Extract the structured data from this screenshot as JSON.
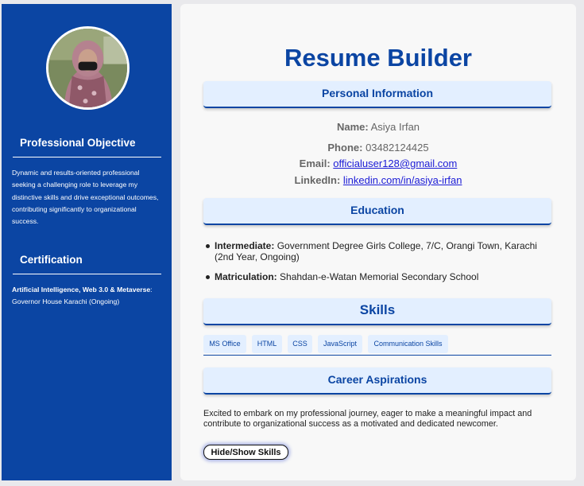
{
  "sidebar": {
    "objective_heading": "Professional Objective",
    "objective_text": "Dynamic and results-oriented professional seeking a challenging role to leverage my distinctive skills and drive exceptional outcomes, contributing significantly to organizational success.",
    "certification_heading": "Certification",
    "certification_name": "Artificial Intelligence, Web 3.0 & Metaverse",
    "certification_detail": ": Governor House Karachi (Ongoing)"
  },
  "main": {
    "title": "Resume Builder",
    "personal_heading": "Personal Information",
    "name_label": "Name:",
    "name_value": "Asiya Irfan",
    "phone_label": "Phone:",
    "phone_value": "03482124425",
    "email_label": "Email:",
    "email_value": "officialuser128@gmail.com",
    "linkedin_label": "LinkedIn:",
    "linkedin_value": "linkedin.com/in/asiya-irfan",
    "education_heading": "Education",
    "education": [
      {
        "level": "Intermediate:",
        "detail": "Government Degree Girls College, 7/C, Orangi Town, Karachi (2nd Year, Ongoing)"
      },
      {
        "level": "Matriculation:",
        "detail": "Shahdan-e-Watan Memorial Secondary School"
      }
    ],
    "skills_heading": "Skills",
    "skills": [
      "MS Office",
      "HTML",
      "CSS",
      "JavaScript",
      "Communication Skills"
    ],
    "career_heading": "Career Aspirations",
    "career_text": "Excited to embark on my professional journey, eager to make a meaningful impact and contribute to organizational success as a motivated and dedicated newcomer.",
    "toggle_label": "Hide/Show Skills"
  },
  "colors": {
    "primary": "#0b45a3",
    "section_bg": "#e3efff",
    "link": "#1b1bd6"
  }
}
